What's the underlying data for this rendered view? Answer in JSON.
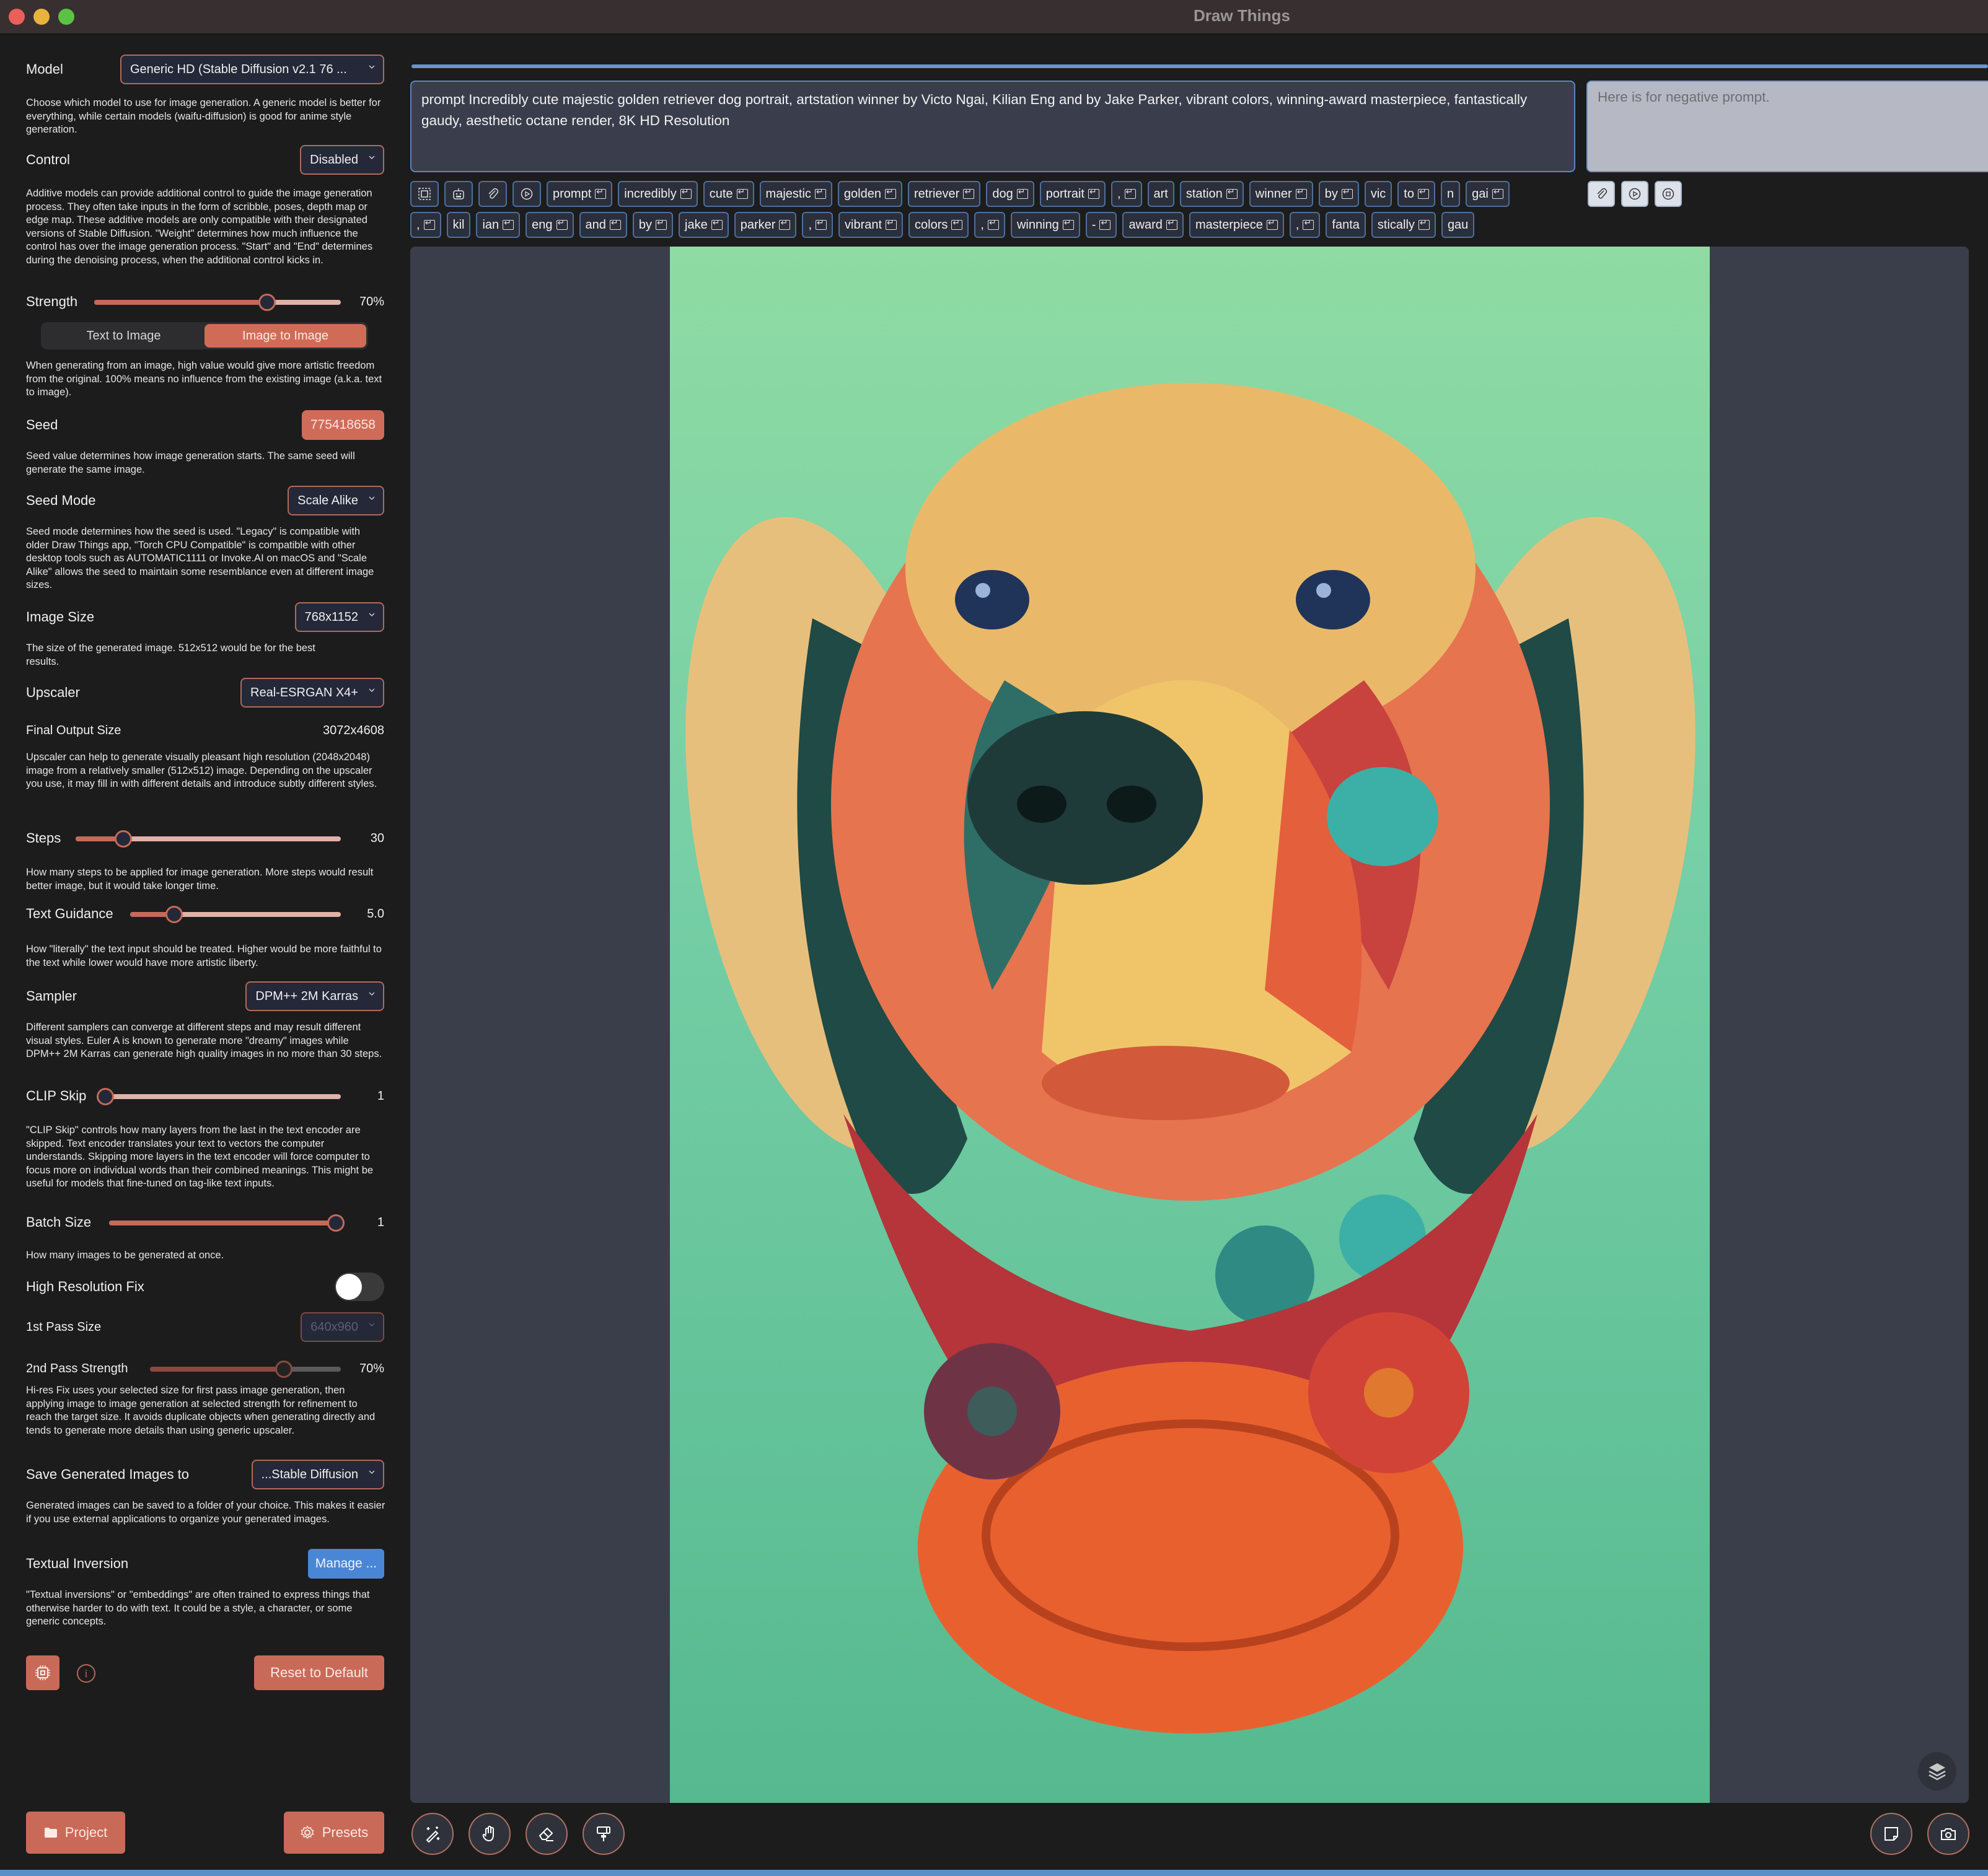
{
  "window": {
    "title": "Draw Things"
  },
  "sidebar": {
    "model": {
      "label": "Model",
      "value": "Generic HD (Stable Diffusion v2.1 76 ...",
      "desc": "Choose which model to use for image generation. A generic model is better for everything, while certain models (waifu-diffusion) is good for anime style generation."
    },
    "control": {
      "label": "Control",
      "value": "Disabled",
      "desc": "Additive models can provide additional control to guide the image generation process. They often take inputs in the form of scribble, poses, depth map or edge map. These additive models are only compatible with their designated versions of Stable Diffusion. \"Weight\" determines how much influence the control has over the image generation process. \"Start\" and \"End\" determines during the denoising process, when the additional control kicks in."
    },
    "strength": {
      "label": "Strength",
      "value_text": "70%",
      "fraction": 0.7,
      "desc": "When generating from an image, high value would give more artistic freedom from the original. 100% means no influence from the existing image (a.k.a. text to image)."
    },
    "mode": {
      "options": [
        "Text to Image",
        "Image to Image"
      ],
      "selected": "Image to Image"
    },
    "seed": {
      "label": "Seed",
      "value": "775418658",
      "desc": "Seed value determines how image generation starts. The same seed will generate the same image."
    },
    "seed_mode": {
      "label": "Seed Mode",
      "value": "Scale Alike",
      "desc": "Seed mode determines how the seed is used. \"Legacy\" is compatible with older Draw Things app, \"Torch CPU Compatible\" is compatible with other desktop tools such as AUTOMATIC1111 or Invoke.AI on macOS and \"Scale Alike\" allows the seed to maintain some resemblance even at different image sizes."
    },
    "image_size": {
      "label": "Image Size",
      "value": "768x1152",
      "desc": "The size of the generated image. 512x512 would be for the best results."
    },
    "upscaler": {
      "label": "Upscaler",
      "value": "Real-ESRGAN X4+"
    },
    "final_output": {
      "label": "Final Output Size",
      "value": "3072x4608",
      "desc": "Upscaler can help to generate visually pleasant high resolution (2048x2048) image from a relatively smaller (512x512) image. Depending on the upscaler you use, it may fill in with different details and introduce subtly different styles."
    },
    "steps": {
      "label": "Steps",
      "value_text": "30",
      "fraction": 0.18,
      "desc": "How many steps to be applied for image generation. More steps would result better image, but it would take longer time."
    },
    "text_guidance": {
      "label": "Text Guidance",
      "value_text": "5.0",
      "fraction": 0.21,
      "desc": "How \"literally\" the text input should be treated. Higher would be more faithful to the text while lower would have more artistic liberty."
    },
    "sampler": {
      "label": "Sampler",
      "value": "DPM++ 2M Karras",
      "desc": "Different samplers can converge at different steps and may result different visual styles. Euler A is known to generate more \"dreamy\" images while DPM++ 2M Karras can generate high quality images in no more than 30 steps."
    },
    "clip_skip": {
      "label": "CLIP Skip",
      "value_text": "1",
      "fraction": 0.0,
      "desc": "\"CLIP Skip\" controls how many layers from the last in the text encoder are skipped. Text encoder translates your text to vectors the computer understands. Skipping more layers in the text encoder will force computer to focus more on individual words than their combined meanings. This might be useful for models that fine-tuned on tag-like text inputs."
    },
    "batch_size": {
      "label": "Batch Size",
      "value_text": "1",
      "fraction": 1.0,
      "desc": "How many images to be generated at once."
    },
    "hires_fix": {
      "label": "High Resolution Fix",
      "enabled": false
    },
    "first_pass": {
      "label": "1st Pass Size",
      "value": "640x960"
    },
    "second_pass": {
      "label": "2nd Pass Strength",
      "value_text": "70%",
      "fraction": 0.7,
      "desc": "Hi-res Fix uses your selected size for first pass image generation, then applying image to image generation at selected strength for refinement to reach the target size. It avoids duplicate objects when generating directly and tends to generate more details than using generic upscaler."
    },
    "save_to": {
      "label": "Save Generated Images to",
      "value": "...Stable Diffusion",
      "desc": "Generated images can be saved to a folder of your choice. This makes it easier if you use external applications to organize your generated images."
    },
    "textual_inversion": {
      "label": "Textual Inversion",
      "button": "Manage ...",
      "desc": "\"Textual inversions\" or \"embeddings\" are often trained to express things that otherwise harder to do with text. It could be a style, a character, or some generic concepts."
    },
    "reset_button": "Reset to Default",
    "project_button": "Project",
    "presets_button": "Presets"
  },
  "prompt": {
    "text": "prompt Incredibly cute majestic golden retriever dog portrait, artstation winner by Victo Ngai, Kilian Eng and by Jake Parker, vibrant colors, winning-award masterpiece, fantastically gaudy, aesthetic octane render, 8K HD Resolution",
    "negative_placeholder": "Here is for negative prompt.",
    "tokens_row1": [
      {
        "t": "prompt",
        "r": true
      },
      {
        "t": "incredibly",
        "r": true
      },
      {
        "t": "cute",
        "r": true
      },
      {
        "t": "majestic",
        "r": true
      },
      {
        "t": "golden",
        "r": true
      },
      {
        "t": "retriever",
        "r": true
      },
      {
        "t": "dog",
        "r": true
      },
      {
        "t": "portrait",
        "r": true
      },
      {
        "t": ",",
        "r": true
      },
      {
        "t": "art",
        "r": false
      },
      {
        "t": "station",
        "r": true
      },
      {
        "t": "winner",
        "r": true
      },
      {
        "t": "by",
        "r": true
      },
      {
        "t": "vic",
        "r": false
      },
      {
        "t": "to",
        "r": true
      },
      {
        "t": "n",
        "r": false
      },
      {
        "t": "gai",
        "r": true
      }
    ],
    "tokens_row2": [
      {
        "t": ",",
        "r": true
      },
      {
        "t": "kil",
        "r": false
      },
      {
        "t": "ian",
        "r": true
      },
      {
        "t": "eng",
        "r": true
      },
      {
        "t": "and",
        "r": true
      },
      {
        "t": "by",
        "r": true
      },
      {
        "t": "jake",
        "r": true
      },
      {
        "t": "parker",
        "r": true
      },
      {
        "t": ",",
        "r": true
      },
      {
        "t": "vibrant",
        "r": true
      },
      {
        "t": "colors",
        "r": true
      },
      {
        "t": ",",
        "r": true
      },
      {
        "t": "winning",
        "r": true
      },
      {
        "t": "-",
        "r": true
      },
      {
        "t": "award",
        "r": true
      },
      {
        "t": "masterpiece",
        "r": true
      },
      {
        "t": ",",
        "r": true
      },
      {
        "t": "fanta",
        "r": false
      },
      {
        "t": "stically",
        "r": true
      },
      {
        "t": "gau",
        "r": false
      }
    ]
  },
  "icons": {
    "prompt_tools": [
      "select-region-icon",
      "robot-icon",
      "paperclip-icon",
      "play-circle-icon"
    ],
    "negative_tools": [
      "paperclip-icon",
      "play-circle-icon",
      "stop-circle-icon"
    ],
    "canvas_tools": [
      "magic-wand-icon",
      "hand-icon",
      "eraser-icon",
      "paint-roller-icon"
    ],
    "canvas_right_tools": [
      "sticky-note-icon",
      "camera-icon"
    ]
  },
  "colors": {
    "accent": "#c96a58",
    "progress": "#6596cc",
    "manage": "#4a86d6"
  }
}
